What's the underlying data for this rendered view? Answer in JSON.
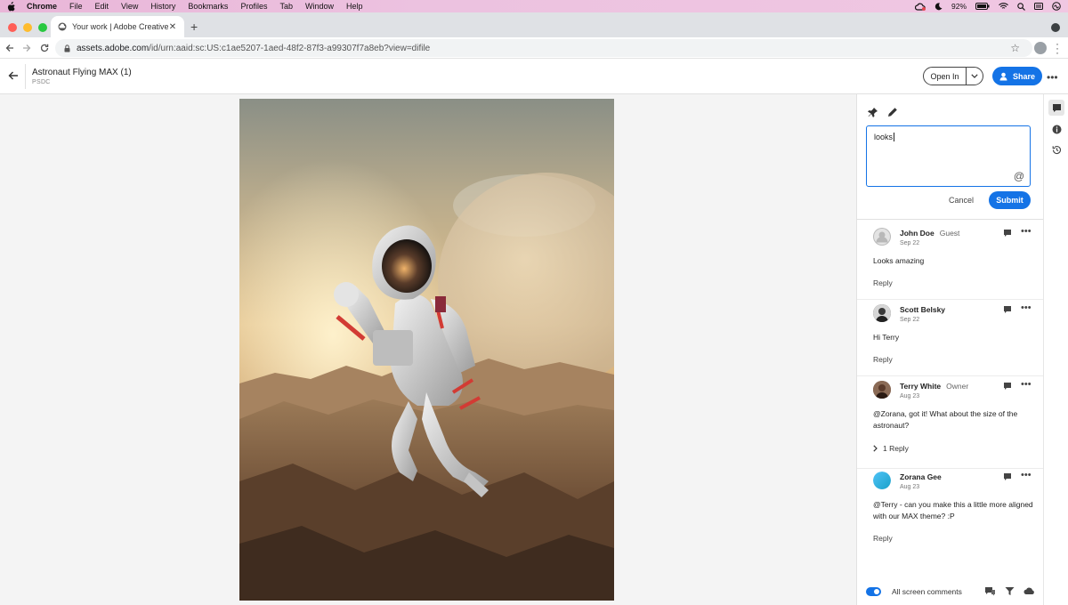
{
  "menubar": {
    "app": "Chrome",
    "items": [
      "File",
      "Edit",
      "View",
      "History",
      "Bookmarks",
      "Profiles",
      "Tab",
      "Window",
      "Help"
    ],
    "battery": "92%"
  },
  "browser": {
    "tab_title": "Your work | Adobe Creative Cl",
    "url_host": "assets.adobe.com",
    "url_path": "/id/urn:aaid:sc:US:c1ae5207-1aed-48f2-87f3-a99307f7a8eb?view=difile"
  },
  "header": {
    "title": "Astronaut Flying MAX (1)",
    "file_type": "PSDC",
    "open_in": "Open In",
    "share": "Share"
  },
  "composer": {
    "value": "looks",
    "at_symbol": "@",
    "cancel": "Cancel",
    "submit": "Submit"
  },
  "comments": [
    {
      "name": "John Doe",
      "role": "Guest",
      "date": "Sep 22",
      "body": "Looks amazing",
      "reply": "Reply"
    },
    {
      "name": "Scott Belsky",
      "role": "",
      "date": "Sep 22",
      "body": "Hi Terry",
      "reply": "Reply"
    },
    {
      "name": "Terry White",
      "role": "Owner",
      "date": "Aug 23",
      "body": "@Zorana, got it! What about the size of the astronaut?",
      "replies": "1 Reply"
    },
    {
      "name": "Zorana Gee",
      "role": "",
      "date": "Aug 23",
      "body": "@Terry - can you make this a little more aligned with our MAX theme? :P",
      "reply": "Reply"
    }
  ],
  "footer": {
    "toggle_label": "All screen comments",
    "toggle_on": true
  },
  "colors": {
    "accent": "#1473e6",
    "menubar": "#ecc2e0"
  }
}
